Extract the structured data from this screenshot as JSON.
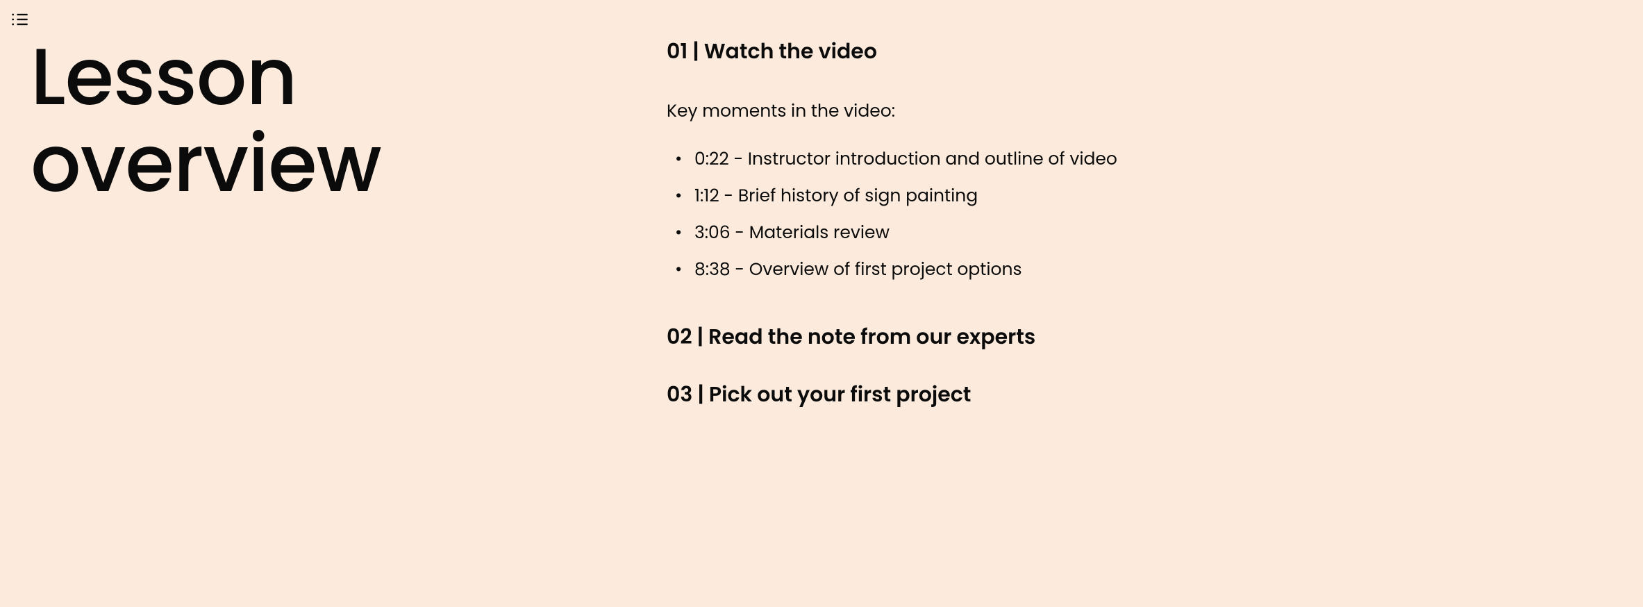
{
  "title": "Lesson overview",
  "steps": [
    {
      "number": "01",
      "label": "Watch the video",
      "spacer": " "
    },
    {
      "number": "02",
      "label": "Read the note from our experts",
      "spacer": ""
    },
    {
      "number": "03",
      "label": "Pick out your first project",
      "spacer": ""
    }
  ],
  "key_moments_label": "Key moments in the video:",
  "key_moments": [
    "0:22 - Instructor introduction and outline of video",
    "1:12 - Brief history of sign painting",
    "3:06 - Materials review",
    "8:38 - Overview of first project options"
  ]
}
